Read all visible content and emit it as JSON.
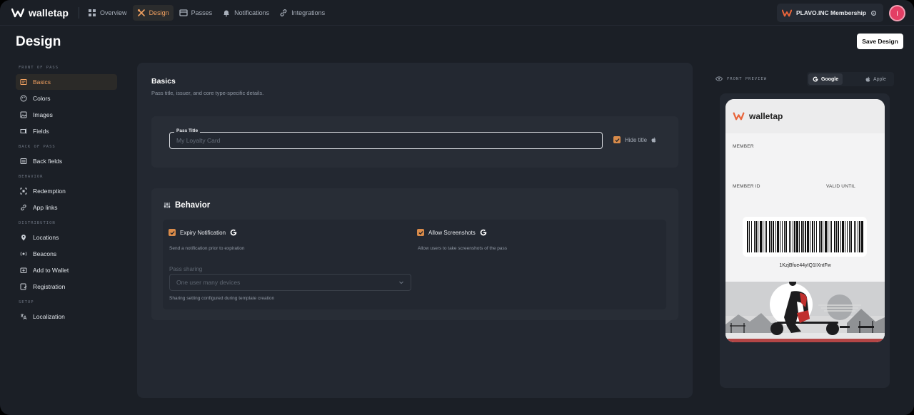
{
  "app": {
    "brand": "walletap"
  },
  "nav": {
    "items": [
      {
        "label": "Overview",
        "icon": "grid-icon"
      },
      {
        "label": "Design",
        "icon": "design-tools-icon",
        "active": true
      },
      {
        "label": "Passes",
        "icon": "passes-icon"
      },
      {
        "label": "Notifications",
        "icon": "bell-icon"
      },
      {
        "label": "Integrations",
        "icon": "link-icon"
      }
    ]
  },
  "account": {
    "membership": "PLAVO.INC Membership",
    "avatar_initial": "I"
  },
  "header": {
    "title": "Design",
    "save_label": "Save Design"
  },
  "sidebar": {
    "sections": [
      {
        "title": "FRONT OF PASS",
        "items": [
          {
            "label": "Basics",
            "icon": "basics-icon",
            "active": true
          },
          {
            "label": "Colors",
            "icon": "palette-icon"
          },
          {
            "label": "Images",
            "icon": "image-icon"
          },
          {
            "label": "Fields",
            "icon": "fields-icon"
          }
        ]
      },
      {
        "title": "BACK OF PASS",
        "items": [
          {
            "label": "Back fields",
            "icon": "back-fields-icon"
          }
        ]
      },
      {
        "title": "BEHAVIOR",
        "items": [
          {
            "label": "Redemption",
            "icon": "scan-icon"
          },
          {
            "label": "App links",
            "icon": "link-icon"
          }
        ]
      },
      {
        "title": "DISTRIBUTION",
        "items": [
          {
            "label": "Locations",
            "icon": "location-pin-icon"
          },
          {
            "label": "Beacons",
            "icon": "beacon-icon"
          },
          {
            "label": "Add to Wallet",
            "icon": "wallet-icon"
          },
          {
            "label": "Registration",
            "icon": "registration-icon"
          }
        ]
      },
      {
        "title": "SETUP",
        "items": [
          {
            "label": "Localization",
            "icon": "translate-icon"
          }
        ]
      }
    ]
  },
  "basics": {
    "title": "Basics",
    "subtitle": "Pass title, issuer, and core type-specific details.",
    "pass_title_label": "Pass Title",
    "pass_title_value": "",
    "pass_title_placeholder": "My Loyalty Card",
    "hide_title_label": "Hide title",
    "hide_title_checked": true
  },
  "behavior": {
    "title": "Behavior",
    "expiry_label": "Expiry Notification",
    "expiry_desc": "Send a notification prior to expiration",
    "expiry_checked": true,
    "screenshots_label": "Allow Screenshots",
    "screenshots_desc": "Allow users to take screenshots of the pass",
    "screenshots_checked": true,
    "sharing_label": "Pass sharing",
    "sharing_value": "One user many devices",
    "sharing_help": "Sharing setting configured during template creation"
  },
  "preview": {
    "label": "FRONT PREVIEW",
    "google_label": "Google",
    "apple_label": "Apple",
    "active_platform": "Google",
    "pass": {
      "brand": "walletap",
      "member_label": "MEMBER",
      "member_id_label": "MEMBER ID",
      "valid_until_label": "VALID UNTIL",
      "barcode_text": "1KzjBfue44yIQ1IXntFw"
    }
  },
  "colors": {
    "accent": "#d98b4a",
    "active_text": "#f0a060",
    "avatar": "#e33e64"
  }
}
